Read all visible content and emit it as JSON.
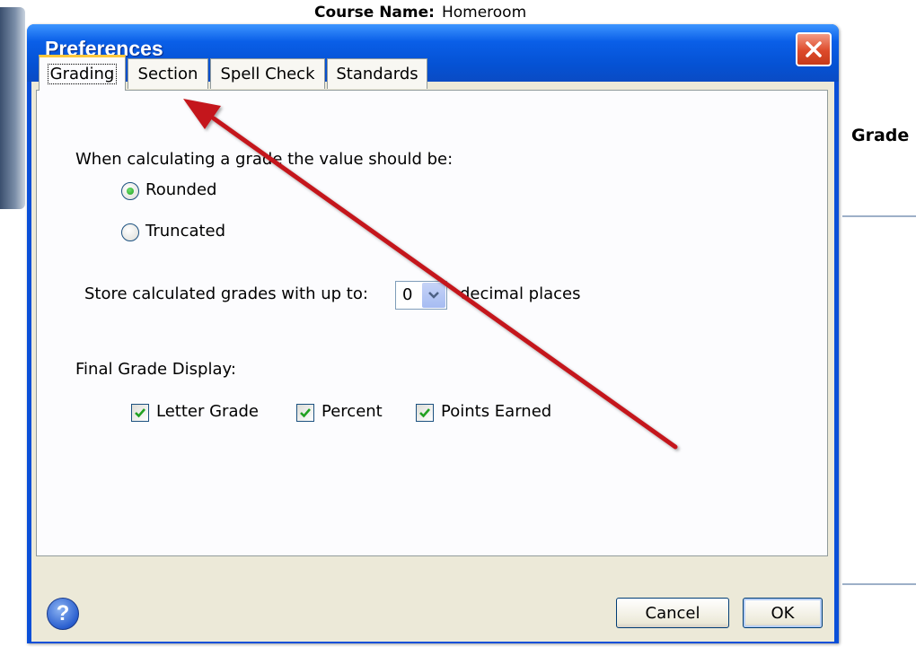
{
  "background": {
    "course_label": "Course Name:",
    "course_value": "Homeroom",
    "grade_header": "Grade"
  },
  "dialog": {
    "title": "Preferences",
    "tabs": [
      {
        "label": "Grading",
        "active": true
      },
      {
        "label": "Section",
        "active": false
      },
      {
        "label": "Spell Check",
        "active": false
      },
      {
        "label": "Standards",
        "active": false
      }
    ],
    "grading": {
      "calc_prompt": "When calculating a grade the value should be:",
      "rounding_options": [
        {
          "label": "Rounded",
          "selected": true
        },
        {
          "label": "Truncated",
          "selected": false
        }
      ],
      "store_prefix": "Store calculated grades with up to:",
      "decimal_value": "0",
      "store_suffix": "decimal places",
      "final_display_label": "Final Grade Display:",
      "display_options": [
        {
          "label": "Letter Grade",
          "checked": true
        },
        {
          "label": "Percent",
          "checked": true
        },
        {
          "label": "Points Earned",
          "checked": true
        }
      ]
    },
    "buttons": {
      "cancel": "Cancel",
      "ok": "OK"
    },
    "help_symbol": "?"
  },
  "colors": {
    "titlebar": "#0a5fe8",
    "dialog_body": "#ece9d8",
    "annotation_arrow": "#c4141a"
  },
  "annotation": {
    "type": "arrow",
    "points_to": "tab-section"
  }
}
